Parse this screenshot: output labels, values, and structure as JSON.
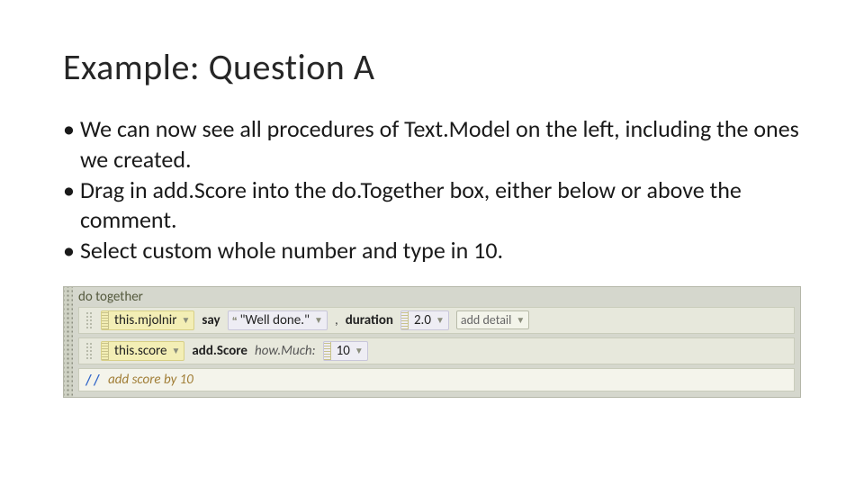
{
  "slide": {
    "title": "Example: Question A",
    "bullets": [
      "We can now see all procedures of Text.Model on the left, including the ones we created.",
      "Drag in add.Score into the do.Together box, either below or above the comment.",
      "Select custom whole number and type in 10."
    ]
  },
  "code": {
    "do_together_label": "do together",
    "row1": {
      "target": "this.mjolnir",
      "method": "say",
      "arg_text": "\"Well done.\"",
      "duration_label": "duration",
      "duration_value": "2.0",
      "add_detail": "add detail"
    },
    "row2": {
      "target": "this.score",
      "method": "add.Score",
      "param_label": "how.Much:",
      "param_value": "10"
    },
    "comment": {
      "slashes": "//",
      "text": "add score by 10"
    }
  }
}
